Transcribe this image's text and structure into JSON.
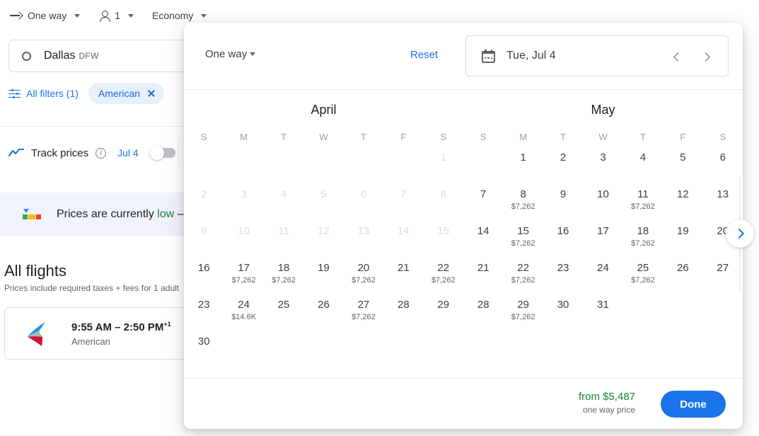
{
  "topbar": {
    "trip_type": "One way",
    "passengers": "1",
    "cabin": "Economy"
  },
  "origin": {
    "city": "Dallas",
    "code": "DFW"
  },
  "filters": {
    "all_filters_label": "All filters (1)",
    "chip_label": "American"
  },
  "track": {
    "label": "Track prices",
    "date_link": "Jul 4"
  },
  "banner": {
    "text_before": "Prices are currently ",
    "text_highlight": "low",
    "text_after": " –"
  },
  "results": {
    "heading": "All flights",
    "note": "Prices include required taxes + fees for 1 adult",
    "flight": {
      "times": "9:55 AM – 2:50 PM",
      "plus_days": "+1",
      "airline": "American"
    }
  },
  "popup": {
    "trip_type": "One way",
    "reset_label": "Reset",
    "date_value": "Tue, Jul 4",
    "footer": {
      "price": "from $5,487",
      "price_note": "one way price",
      "done_label": "Done"
    },
    "weekday_headers": [
      "S",
      "M",
      "T",
      "W",
      "T",
      "F",
      "S"
    ],
    "months": [
      {
        "name": "April",
        "lead_blanks": 6,
        "days": [
          {
            "day": "1",
            "price": "",
            "disabled": true
          },
          {
            "day": "2",
            "price": "",
            "disabled": true
          },
          {
            "day": "3",
            "price": "",
            "disabled": true
          },
          {
            "day": "4",
            "price": "",
            "disabled": true
          },
          {
            "day": "5",
            "price": "",
            "disabled": true
          },
          {
            "day": "6",
            "price": "",
            "disabled": true
          },
          {
            "day": "7",
            "price": "",
            "disabled": true
          },
          {
            "day": "8",
            "price": "",
            "disabled": true
          },
          {
            "day": "9",
            "price": "",
            "disabled": true
          },
          {
            "day": "10",
            "price": "",
            "disabled": true
          },
          {
            "day": "11",
            "price": "",
            "disabled": true
          },
          {
            "day": "12",
            "price": "",
            "disabled": true
          },
          {
            "day": "13",
            "price": "",
            "disabled": true
          },
          {
            "day": "14",
            "price": "",
            "disabled": true
          },
          {
            "day": "15",
            "price": "",
            "disabled": true
          },
          {
            "day": "16",
            "price": "",
            "disabled": false
          },
          {
            "day": "17",
            "price": "$7,262",
            "disabled": false
          },
          {
            "day": "18",
            "price": "$7,262",
            "disabled": false
          },
          {
            "day": "19",
            "price": "",
            "disabled": false
          },
          {
            "day": "20",
            "price": "$7,262",
            "disabled": false
          },
          {
            "day": "21",
            "price": "",
            "disabled": false
          },
          {
            "day": "22",
            "price": "$7,262",
            "disabled": false
          },
          {
            "day": "23",
            "price": "",
            "disabled": false
          },
          {
            "day": "24",
            "price": "$14.6K",
            "disabled": false
          },
          {
            "day": "25",
            "price": "",
            "disabled": false
          },
          {
            "day": "26",
            "price": "",
            "disabled": false
          },
          {
            "day": "27",
            "price": "$7,262",
            "disabled": false
          },
          {
            "day": "28",
            "price": "",
            "disabled": false
          },
          {
            "day": "29",
            "price": "",
            "disabled": false
          },
          {
            "day": "30",
            "price": "",
            "disabled": false
          }
        ]
      },
      {
        "name": "May",
        "lead_blanks": 1,
        "days": [
          {
            "day": "1",
            "price": "",
            "disabled": false
          },
          {
            "day": "2",
            "price": "",
            "disabled": false
          },
          {
            "day": "3",
            "price": "",
            "disabled": false
          },
          {
            "day": "4",
            "price": "",
            "disabled": false
          },
          {
            "day": "5",
            "price": "",
            "disabled": false
          },
          {
            "day": "6",
            "price": "",
            "disabled": false
          },
          {
            "day": "7",
            "price": "",
            "disabled": false
          },
          {
            "day": "8",
            "price": "$7,262",
            "disabled": false
          },
          {
            "day": "9",
            "price": "",
            "disabled": false
          },
          {
            "day": "10",
            "price": "",
            "disabled": false
          },
          {
            "day": "11",
            "price": "$7,262",
            "disabled": false
          },
          {
            "day": "12",
            "price": "",
            "disabled": false
          },
          {
            "day": "13",
            "price": "",
            "disabled": false
          },
          {
            "day": "14",
            "price": "",
            "disabled": false
          },
          {
            "day": "15",
            "price": "$7,262",
            "disabled": false
          },
          {
            "day": "16",
            "price": "",
            "disabled": false
          },
          {
            "day": "17",
            "price": "",
            "disabled": false
          },
          {
            "day": "18",
            "price": "$7,262",
            "disabled": false
          },
          {
            "day": "19",
            "price": "",
            "disabled": false
          },
          {
            "day": "20",
            "price": "",
            "disabled": false
          },
          {
            "day": "21",
            "price": "",
            "disabled": false
          },
          {
            "day": "22",
            "price": "$7,262",
            "disabled": false
          },
          {
            "day": "23",
            "price": "",
            "disabled": false
          },
          {
            "day": "24",
            "price": "",
            "disabled": false
          },
          {
            "day": "25",
            "price": "$7,262",
            "disabled": false
          },
          {
            "day": "26",
            "price": "",
            "disabled": false
          },
          {
            "day": "27",
            "price": "",
            "disabled": false
          },
          {
            "day": "28",
            "price": "",
            "disabled": false
          },
          {
            "day": "29",
            "price": "$7,262",
            "disabled": false
          },
          {
            "day": "30",
            "price": "",
            "disabled": false
          },
          {
            "day": "31",
            "price": "",
            "disabled": false
          }
        ]
      }
    ]
  },
  "colors": {
    "accent_blue": "#1a73e8",
    "chip_bg": "#e8f0fe",
    "green": "#188038",
    "disabled_gray": "#dadce0"
  }
}
